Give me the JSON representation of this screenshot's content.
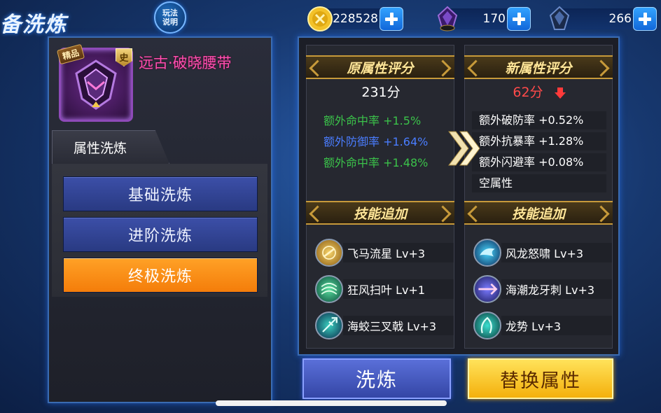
{
  "header": {
    "title": "备洗炼",
    "help_label": "玩法\n说明"
  },
  "currencies": [
    {
      "name": "gold",
      "value": "228528"
    },
    {
      "name": "crystal-a",
      "value": "170"
    },
    {
      "name": "crystal-b",
      "value": "266"
    }
  ],
  "item": {
    "quality_tag": "精品",
    "grade": "史",
    "name": "远古·破晓腰带"
  },
  "left_panel": {
    "tab_label": "属性洗炼",
    "menu": [
      {
        "label": "基础洗炼",
        "active": false
      },
      {
        "label": "进阶洗炼",
        "active": false
      },
      {
        "label": "终极洗炼",
        "active": true
      }
    ]
  },
  "old_column": {
    "header": "原属性评分",
    "score": "231分",
    "attributes": [
      {
        "text": "额外命中率 +1.5%",
        "color": "#3bc24a"
      },
      {
        "text": "额外防御率 +1.64%",
        "color": "#4a7dff"
      },
      {
        "text": "额外命中率 +1.48%",
        "color": "#3bc24a"
      }
    ],
    "skills_header": "技能追加",
    "skills": [
      {
        "icon": "golden-emblem-icon",
        "text": "飞马流星 Lv+3"
      },
      {
        "icon": "green-fan-icon",
        "text": "狂风扫叶 Lv+1"
      },
      {
        "icon": "trident-icon",
        "text": "海蛟三叉戟 Lv+3"
      }
    ]
  },
  "new_column": {
    "header": "新属性评分",
    "score": "62分",
    "attributes": [
      {
        "text": "额外破防率 +0.52%"
      },
      {
        "text": "额外抗暴率 +1.28%"
      },
      {
        "text": "额外闪避率 +0.08%"
      },
      {
        "text": "空属性"
      }
    ],
    "skills_header": "技能追加",
    "skills": [
      {
        "icon": "dragon-roar-icon",
        "text": "风龙怒啸 Lv+3"
      },
      {
        "icon": "dragon-fang-icon",
        "text": "海潮龙牙刺 Lv+3"
      },
      {
        "icon": "dragon-stance-icon",
        "text": "龙势 Lv+3"
      }
    ]
  },
  "actions": {
    "refine_label": "洗炼",
    "replace_label": "替换属性"
  }
}
